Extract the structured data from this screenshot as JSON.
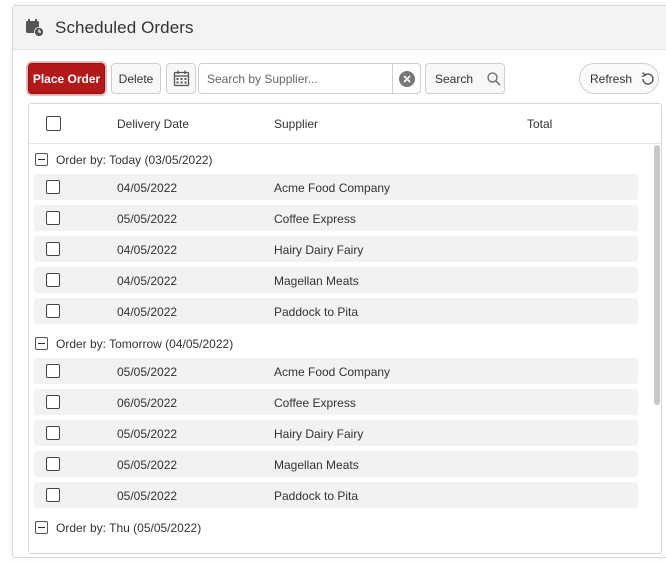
{
  "header": {
    "title": "Scheduled Orders",
    "icon": "calendar-clock-icon"
  },
  "toolbar": {
    "place_order_label": "Place Order",
    "delete_label": "Delete",
    "calendar_icon": "calendar-icon",
    "search_placeholder": "Search by Supplier...",
    "search_value": "",
    "search_label": "Search",
    "refresh_label": "Refresh"
  },
  "columns": {
    "delivery_date": "Delivery Date",
    "supplier": "Supplier",
    "total": "Total"
  },
  "groups": [
    {
      "label": "Order by: Today (03/05/2022)",
      "rows": [
        {
          "date": "04/05/2022",
          "supplier": "Acme Food Company"
        },
        {
          "date": "05/05/2022",
          "supplier": "Coffee Express"
        },
        {
          "date": "04/05/2022",
          "supplier": "Hairy Dairy Fairy"
        },
        {
          "date": "04/05/2022",
          "supplier": "Magellan Meats"
        },
        {
          "date": "04/05/2022",
          "supplier": "Paddock to Pita"
        }
      ]
    },
    {
      "label": "Order by: Tomorrow (04/05/2022)",
      "rows": [
        {
          "date": "05/05/2022",
          "supplier": "Acme Food Company"
        },
        {
          "date": "06/05/2022",
          "supplier": "Coffee Express"
        },
        {
          "date": "05/05/2022",
          "supplier": "Hairy Dairy Fairy"
        },
        {
          "date": "05/05/2022",
          "supplier": "Magellan Meats"
        },
        {
          "date": "05/05/2022",
          "supplier": "Paddock to Pita"
        }
      ]
    },
    {
      "label": "Order by: Thu (05/05/2022)",
      "rows": []
    }
  ],
  "colors": {
    "primary": "#b3191b",
    "row_bg": "#f2f2f2",
    "header_bg": "#f3f3f3"
  }
}
